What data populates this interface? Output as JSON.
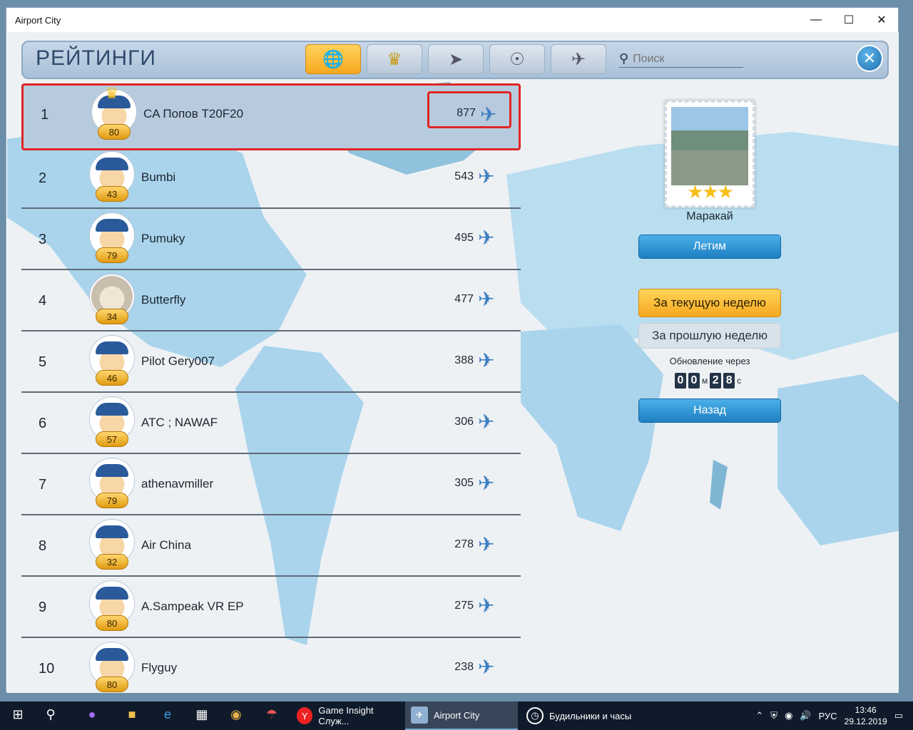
{
  "window": {
    "title": "Airport City",
    "minimize_icon": "minimize-icon",
    "maximize_icon": "maximize-icon",
    "close_icon": "close-icon"
  },
  "header": {
    "title": "РЕЙТИНГИ",
    "tabs": [
      {
        "icon": "globe-icon",
        "active": true
      },
      {
        "icon": "wings-badge-icon",
        "active": false
      },
      {
        "icon": "rocket-icon",
        "active": false
      },
      {
        "icon": "satellite-icon",
        "active": false
      },
      {
        "icon": "shuttle-icon",
        "active": false
      }
    ],
    "search_placeholder": "Поиск"
  },
  "rankings": [
    {
      "rank": "1",
      "name": "CA Попов T20F20",
      "level": "80",
      "score": "877",
      "avatar": "pilot-crown"
    },
    {
      "rank": "2",
      "name": "Bumbi",
      "level": "43",
      "score": "543",
      "avatar": "pilot"
    },
    {
      "rank": "3",
      "name": "Pumuky",
      "level": "79",
      "score": "495",
      "avatar": "pilot"
    },
    {
      "rank": "4",
      "name": "Butterfly",
      "level": "34",
      "score": "477",
      "avatar": "cat"
    },
    {
      "rank": "5",
      "name": "Pilot Gery007",
      "level": "46",
      "score": "388",
      "avatar": "pilot"
    },
    {
      "rank": "6",
      "name": "ATC ; NAWAF",
      "level": "57",
      "score": "306",
      "avatar": "pilot"
    },
    {
      "rank": "7",
      "name": "athenavmiller",
      "level": "79",
      "score": "305",
      "avatar": "pilot"
    },
    {
      "rank": "8",
      "name": "Air China",
      "level": "32",
      "score": "278",
      "avatar": "pilot"
    },
    {
      "rank": "9",
      "name": "A.Sampeak VR EP",
      "level": "80",
      "score": "275",
      "avatar": "pilot"
    },
    {
      "rank": "10",
      "name": "Flyguy",
      "level": "80",
      "score": "238",
      "avatar": "pilot"
    }
  ],
  "panel": {
    "city": "Маракай",
    "stars": 3,
    "fly_button": "Летим",
    "current_week": "За текущую неделю",
    "previous_week": "За прошлую неделю",
    "refresh_label": "Обновление через",
    "timer_minutes": "00",
    "timer_minutes_unit": "м",
    "timer_seconds": "28",
    "timer_seconds_unit": "с",
    "back_button": "Назад"
  },
  "taskbar": {
    "apps": [
      {
        "label": "Game Insight Служ...",
        "icon": "yandex-browser-icon",
        "active": false
      },
      {
        "label": "Airport City",
        "icon": "airport-city-icon",
        "active": true
      },
      {
        "label": "Будильники и часы",
        "icon": "alarm-clock-icon",
        "active": false
      }
    ],
    "language": "РУС",
    "time": "13:46",
    "date": "29.12.2019"
  },
  "colors": {
    "accent_blue": "#1e7fc2",
    "accent_orange": "#f7a820",
    "highlight_red": "#e02525"
  }
}
